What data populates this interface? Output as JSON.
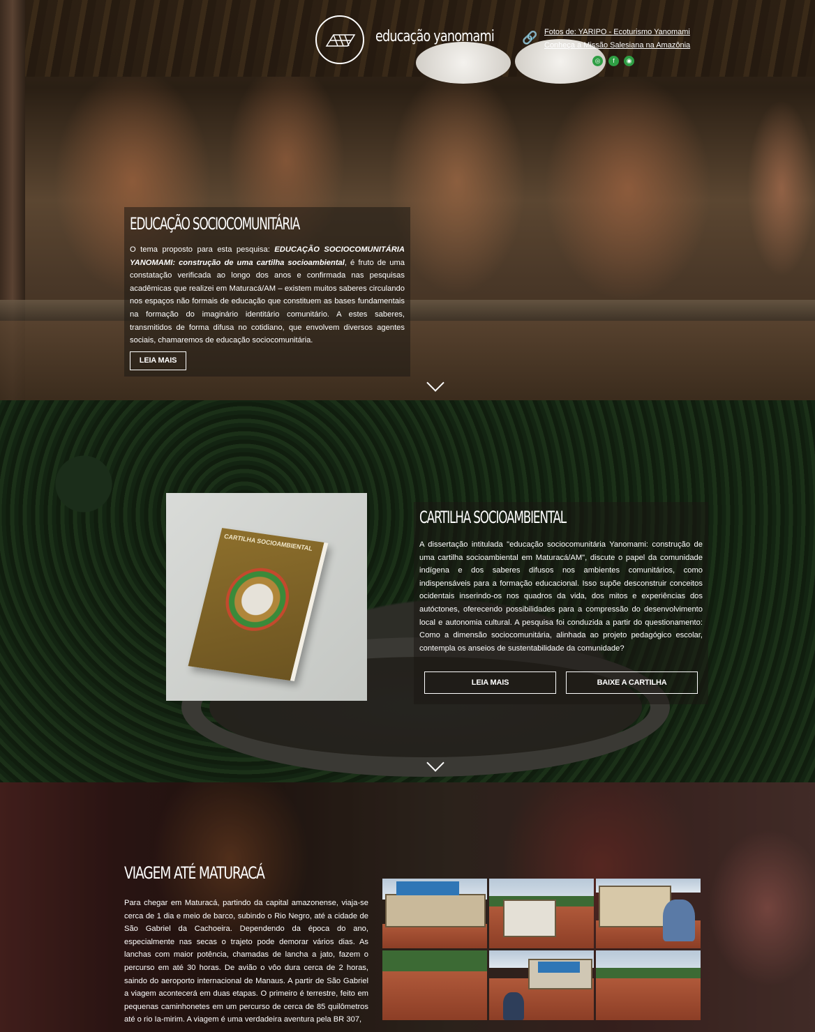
{
  "header": {
    "site_name": "educação yanomami",
    "credits_link": "Fotos de: YARIPO - Ecoturismo Yanomami",
    "mission_link": "Conheça a Missão Salesiana na Amazônia",
    "social_icons": [
      "globe-icon",
      "facebook-icon",
      "instagram-icon"
    ],
    "social_color": "#2f9e44"
  },
  "hero": {
    "title": "EDUCAÇÃO SOCIOCOMUNITÁRIA",
    "text_lead": "O tema proposto para esta pesquisa: ",
    "text_emphasis": "EDUCAÇÃO SOCIOCOMUNITÁRIA YANOMAMI: construção de uma cartilha socioambiental",
    "text_rest": ", é fruto de uma constatação verificada ao longo dos anos e confirmada nas pesquisas acadêmicas que realizei em Maturacá/AM – existem muitos saberes circulando nos espaços não formais de educação que constituem as bases fundamentais na formação do imaginário identitário comunitário. A estes saberes, transmitidos de forma difusa no cotidiano, que envolvem diversos agentes sociais, chamaremos de educação sociocomunitária.",
    "button": "LEIA MAIS"
  },
  "cartilha": {
    "title": "CARTILHA SOCIOAMBIENTAL",
    "cover_title": "CARTILHA SOCIOAMBIENTAL",
    "text": "A dissertação intitulada \"educação sociocomunitária Yanomami: construção de uma cartilha socioambiental em Maturacá/AM\", discute o papel da comunidade indígena e dos saberes difusos nos ambientes comunitários, como indispensáveis para a formação educacional. Isso supõe desconstruir conceitos ocidentais inserindo-os nos quadros da vida, dos mitos e experiências dos autóctones, oferecendo possibilidades para a compressão do desenvolvimento local e autonomia cultural. A pesquisa foi conduzida a partir do questionamento: Como a dimensão sociocomunitária, alinhada ao projeto pedagógico escolar, contempla os anseios de sustentabilidade da comunidade?",
    "button_read": "LEIA MAIS",
    "button_download": "BAIXE A CARTILHA"
  },
  "trip": {
    "title": "VIAGEM ATÉ MATURACÁ",
    "text": "Para chegar em Maturacá, partindo da capital amazonense, viaja-se cerca de 1 dia e meio de barco, subindo o Rio Negro, até a cidade de São Gabriel da Cachoeira. Dependendo da época do ano, especialmente nas secas o trajeto pode demorar vários dias. As lanchas com maior potência, chamadas de lancha a jato, fazem o percurso em até 30 horas. De avião o vôo dura cerca de 2 horas, saindo do aeroporto internacional de Manaus. A partir de São Gabriel a viagem acontecerá em duas etapas. O primeiro é terrestre, feito em pequenas caminhonetes em um percurso de cerca de 85 quilômetros até o rio Ia-mirim. A viagem é uma verdadeira aventura pela BR 307,"
  },
  "colors": {
    "card_overlay": "rgba(30,25,20,0.55)",
    "text": "#ffffff"
  }
}
